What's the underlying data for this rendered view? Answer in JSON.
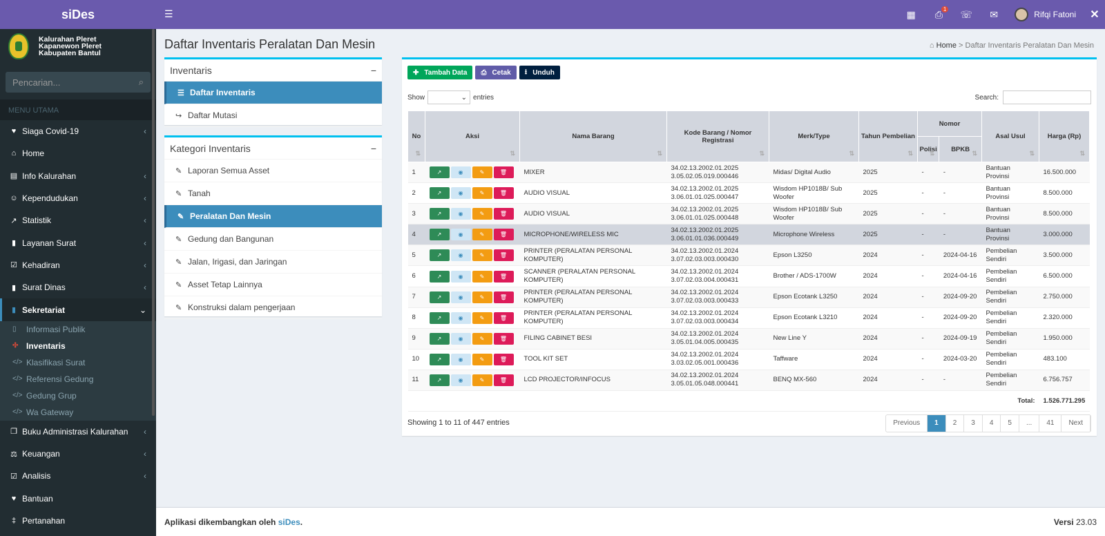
{
  "app": {
    "title": "siDes",
    "org": [
      "Kalurahan Pleret",
      "Kapanewon Pleret",
      "Kabupaten Bantul"
    ],
    "search_placeholder": "Pencarian...",
    "menu_header": "MENU UTAMA"
  },
  "menu": [
    {
      "label": "Siaga Covid-19",
      "icon": "heartbeat-icon",
      "glyph": "♥",
      "chev": true
    },
    {
      "label": "Home",
      "icon": "home-icon",
      "glyph": "⌂",
      "chev": false
    },
    {
      "label": "Info Kalurahan",
      "icon": "bank-icon",
      "glyph": "▤",
      "chev": true
    },
    {
      "label": "Kependudukan",
      "icon": "users-icon",
      "glyph": "☺",
      "chev": true
    },
    {
      "label": "Statistik",
      "icon": "chart-icon",
      "glyph": "↗",
      "chev": true
    },
    {
      "label": "Layanan Surat",
      "icon": "book-icon",
      "glyph": "▮",
      "chev": true
    },
    {
      "label": "Kehadiran",
      "icon": "calendar-check-icon",
      "glyph": "☑",
      "chev": true
    },
    {
      "label": "Surat Dinas",
      "icon": "book-icon",
      "glyph": "▮",
      "chev": true
    }
  ],
  "active_menu": {
    "label": "Sekretariat",
    "chev": "⌄"
  },
  "submenu": [
    {
      "label": "Informasi Publik",
      "icon": "file-icon",
      "glyph": "▯",
      "on": false
    },
    {
      "label": "Inventaris",
      "icon": "cubes-icon",
      "glyph": "✣",
      "on": true
    },
    {
      "label": "Klasifikasi Surat",
      "icon": "code-icon",
      "glyph": "</>",
      "on": false
    },
    {
      "label": "Referensi Gedung",
      "icon": "code-icon",
      "glyph": "</>",
      "on": false
    },
    {
      "label": "Gedung Grup",
      "icon": "code-icon",
      "glyph": "</>",
      "on": false
    },
    {
      "label": "Wa Gateway",
      "icon": "code-icon",
      "glyph": "</>",
      "on": false
    }
  ],
  "menu2": [
    {
      "label": "Buku Administrasi Kalurahan",
      "icon": "copy-icon",
      "glyph": "❐",
      "chev": true
    },
    {
      "label": "Keuangan",
      "icon": "balance-icon",
      "glyph": "⚖",
      "chev": true
    },
    {
      "label": "Analisis",
      "icon": "check-square-icon",
      "glyph": "☑",
      "chev": true
    },
    {
      "label": "Bantuan",
      "icon": "heart-icon",
      "glyph": "♥",
      "chev": false
    },
    {
      "label": "Pertanahan",
      "icon": "signpost-icon",
      "glyph": "‡",
      "chev": false
    }
  ],
  "topbar": {
    "notif_count": "1",
    "user": "Rifqi Fatoni"
  },
  "page": {
    "title": "Daftar Inventaris Peralatan Dan Mesin",
    "crumb_home": "Home",
    "crumb_current": "Daftar Inventaris Peralatan Dan Mesin"
  },
  "inventaris_box": {
    "title": "Inventaris",
    "items": [
      {
        "label": "Daftar Inventaris",
        "sel": true
      },
      {
        "label": "Daftar Mutasi",
        "sel": false
      }
    ]
  },
  "kategori_box": {
    "title": "Kategori Inventaris",
    "items": [
      {
        "label": "Laporan Semua Asset",
        "sel": false
      },
      {
        "label": "Tanah",
        "sel": false
      },
      {
        "label": "Peralatan Dan Mesin",
        "sel": true
      },
      {
        "label": "Gedung dan Bangunan",
        "sel": false
      },
      {
        "label": "Jalan, Irigasi, dan Jaringan",
        "sel": false
      },
      {
        "label": "Asset Tetap Lainnya",
        "sel": false
      },
      {
        "label": "Konstruksi dalam pengerjaan",
        "sel": false
      }
    ]
  },
  "toolbar": {
    "add": "Tambah Data",
    "print": "Cetak",
    "download": "Unduh"
  },
  "table_ctrl": {
    "show": "Show",
    "entries": "entries",
    "search": "Search:"
  },
  "columns": {
    "no": "No",
    "aksi": "Aksi",
    "nama": "Nama Barang",
    "kode": "Kode Barang / Nomor Registrasi",
    "merk": "Merk/Type",
    "tahun": "Tahun Pembelian",
    "nomor": "Nomor",
    "polisi": "Polisi",
    "bpkb": "BPKB",
    "asal": "Asal Usul",
    "harga": "Harga (Rp)"
  },
  "rows": [
    {
      "no": "1",
      "nama": "MIXER",
      "kode": "34.02.13.2002.01.2025 3.05.02.05.019.000446",
      "merk": "Midas/ Digital Audio",
      "tahun": "2025",
      "polisi": "-",
      "bpkb": "-",
      "asal": "Bantuan Provinsi",
      "harga": "16.500.000"
    },
    {
      "no": "2",
      "nama": "AUDIO VISUAL",
      "kode": "34.02.13.2002.01.2025 3.06.01.01.025.000447",
      "merk": "Wisdom HP1018B/ Sub Woofer",
      "tahun": "2025",
      "polisi": "-",
      "bpkb": "-",
      "asal": "Bantuan Provinsi",
      "harga": "8.500.000"
    },
    {
      "no": "3",
      "nama": "AUDIO VISUAL",
      "kode": "34.02.13.2002.01.2025 3.06.01.01.025.000448",
      "merk": "Wisdom HP1018B/ Sub Woofer",
      "tahun": "2025",
      "polisi": "-",
      "bpkb": "-",
      "asal": "Bantuan Provinsi",
      "harga": "8.500.000"
    },
    {
      "no": "4",
      "nama": "MICROPHONE/WIRELESS MIC",
      "kode": "34.02.13.2002.01.2025 3.06.01.01.036.000449",
      "merk": "Microphone Wireless",
      "tahun": "2025",
      "polisi": "-",
      "bpkb": "-",
      "asal": "Bantuan Provinsi",
      "harga": "3.000.000"
    },
    {
      "no": "5",
      "nama": "PRINTER (PERALATAN PERSONAL KOMPUTER)",
      "kode": "34.02.13.2002.01.2024 3.07.02.03.003.000430",
      "merk": "Epson L3250",
      "tahun": "2024",
      "polisi": "-",
      "bpkb": "2024-04-16",
      "asal": "Pembelian Sendiri",
      "harga": "3.500.000"
    },
    {
      "no": "6",
      "nama": "SCANNER (PERALATAN PERSONAL KOMPUTER)",
      "kode": "34.02.13.2002.01.2024 3.07.02.03.004.000431",
      "merk": "Brother / ADS-1700W",
      "tahun": "2024",
      "polisi": "-",
      "bpkb": "2024-04-16",
      "asal": "Pembelian Sendiri",
      "harga": "6.500.000"
    },
    {
      "no": "7",
      "nama": "PRINTER (PERALATAN PERSONAL KOMPUTER)",
      "kode": "34.02.13.2002.01.2024 3.07.02.03.003.000433",
      "merk": "Epson Ecotank L3250",
      "tahun": "2024",
      "polisi": "-",
      "bpkb": "2024-09-20",
      "asal": "Pembelian Sendiri",
      "harga": "2.750.000"
    },
    {
      "no": "8",
      "nama": "PRINTER (PERALATAN PERSONAL KOMPUTER)",
      "kode": "34.02.13.2002.01.2024 3.07.02.03.003.000434",
      "merk": "Epson Ecotank L3210",
      "tahun": "2024",
      "polisi": "-",
      "bpkb": "2024-09-20",
      "asal": "Pembelian Sendiri",
      "harga": "2.320.000"
    },
    {
      "no": "9",
      "nama": "FILING CABINET BESI",
      "kode": "34.02.13.2002.01.2024 3.05.01.04.005.000435",
      "merk": "New Line Y",
      "tahun": "2024",
      "polisi": "-",
      "bpkb": "2024-09-19",
      "asal": "Pembelian Sendiri",
      "harga": "1.950.000"
    },
    {
      "no": "10",
      "nama": "TOOL KIT SET",
      "kode": "34.02.13.2002.01.2024 3.03.02.05.001.000436",
      "merk": "Taffware",
      "tahun": "2024",
      "polisi": "-",
      "bpkb": "2024-03-20",
      "asal": "Pembelian Sendiri",
      "harga": "483.100"
    },
    {
      "no": "11",
      "nama": "LCD PROJECTOR/INFOCUS",
      "kode": "34.02.13.2002.01.2024 3.05.01.05.048.000441",
      "merk": "BENQ MX-560",
      "tahun": "2024",
      "polisi": "-",
      "bpkb": "-",
      "asal": "Pembelian Sendiri",
      "harga": "6.756.757"
    }
  ],
  "highlight_row": "4",
  "total": {
    "label": "Total:",
    "value": "1.526.771.295"
  },
  "info": "Showing 1 to 11 of 447 entries",
  "pagination": [
    "Previous",
    "1",
    "2",
    "3",
    "4",
    "5",
    "...",
    "41",
    "Next"
  ],
  "active_page": "1",
  "footer": {
    "text": "Aplikasi dikembangkan oleh ",
    "link": "siDes",
    "dot": ".",
    "version_label": "Versi",
    "version": "23.03"
  },
  "colors": {
    "purple": "#6a5aad",
    "blue": "#3c8dbc",
    "green": "#00a65a",
    "dark": "#222d32"
  }
}
